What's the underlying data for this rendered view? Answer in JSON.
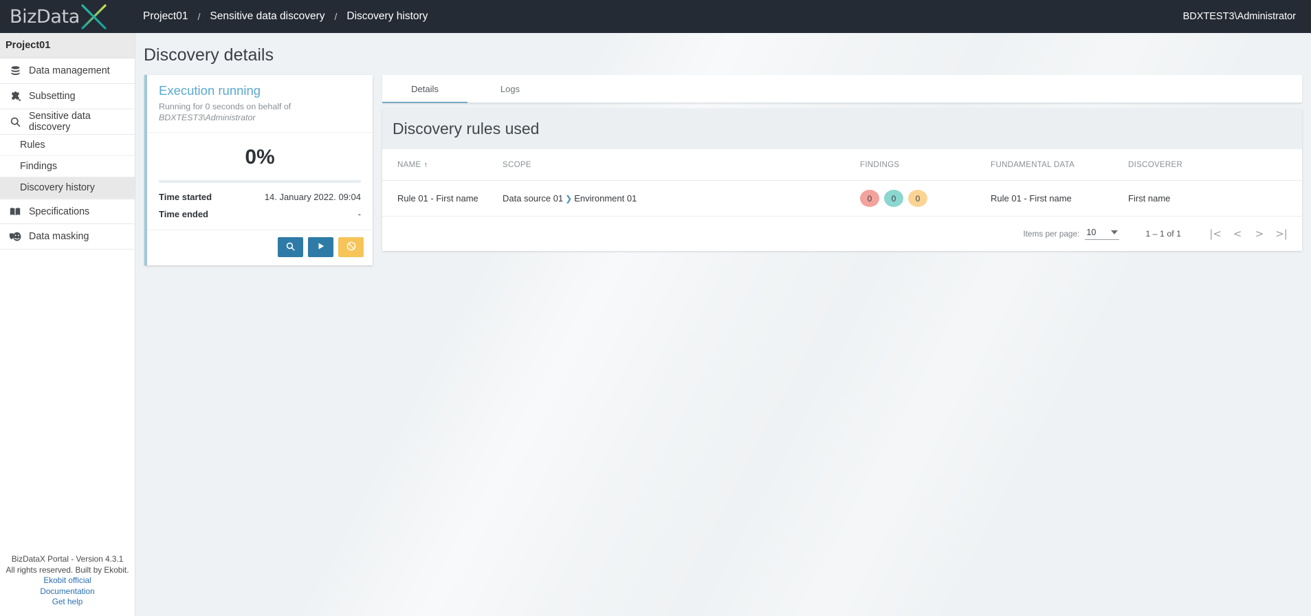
{
  "topbar": {
    "logo_text_main": "BizData",
    "logo_icon": "bizdatax-x-logo",
    "breadcrumb": [
      "Project01",
      "Sensitive data discovery",
      "Discovery history"
    ],
    "separator": "/",
    "user": "BDXTEST3\\Administrator"
  },
  "sidebar": {
    "project": "Project01",
    "items": [
      {
        "label": "Data management",
        "icon": "database-icon"
      },
      {
        "label": "Subsetting",
        "icon": "puzzle-piece-icon"
      },
      {
        "label": "Sensitive data discovery",
        "icon": "search-icon"
      }
    ],
    "sub_items": [
      {
        "label": "Rules",
        "active": false
      },
      {
        "label": "Findings",
        "active": false
      },
      {
        "label": "Discovery history",
        "active": true
      }
    ],
    "items_after": [
      {
        "label": "Specifications",
        "icon": "book-icon"
      },
      {
        "label": "Data masking",
        "icon": "theater-masks-icon"
      }
    ],
    "footer": {
      "version": "BizDataX Portal - Version 4.3.1",
      "rights": "All rights reserved. Built by Ekobit.",
      "links": [
        "Ekobit official",
        "Documentation",
        "Get help"
      ]
    }
  },
  "main": {
    "page_title": "Discovery details",
    "execution": {
      "status_title": "Execution running",
      "subtitle_line1": "Running for 0 seconds on behalf of",
      "subtitle_line2": "BDXTEST3\\Administrator",
      "percent_label": "0%",
      "percent_value": 0,
      "time_started_label": "Time started",
      "time_started_value": "14. January 2022. 09:04",
      "time_ended_label": "Time ended",
      "time_ended_value": "-",
      "actions": [
        {
          "name": "search-button",
          "icon": "search-icon",
          "color": "#2f7ba7"
        },
        {
          "name": "run-button",
          "icon": "play-icon",
          "color": "#2f7ba7"
        },
        {
          "name": "stop-button",
          "icon": "block-icon",
          "color": "#f6c458"
        }
      ]
    },
    "tabs": [
      {
        "label": "Details",
        "active": true
      },
      {
        "label": "Logs",
        "active": false
      }
    ],
    "panel_title": "Discovery rules used",
    "table": {
      "columns": [
        "NAME",
        "SCOPE",
        "FINDINGS",
        "FUNDAMENTAL DATA",
        "DISCOVERER"
      ],
      "sort_column": "NAME",
      "sort_direction": "asc",
      "sort_arrow": "↑",
      "rows": [
        {
          "name": "Rule 01 - First name",
          "scope_source": "Data source 01",
          "scope_sep": "❯",
          "scope_env": "Environment 01",
          "findings": [
            {
              "value": "0",
              "color": "#f3a29c"
            },
            {
              "value": "0",
              "color": "#8bd6cf"
            },
            {
              "value": "0",
              "color": "#fbd493"
            }
          ],
          "fundamental_data": "Rule 01 - First name",
          "discoverer": "First name"
        }
      ]
    },
    "paginator": {
      "items_per_page_label": "Items per page:",
      "items_per_page_value": "10",
      "range": "1 – 1 of 1",
      "buttons": [
        "|<",
        "<",
        ">",
        ">|"
      ]
    }
  }
}
